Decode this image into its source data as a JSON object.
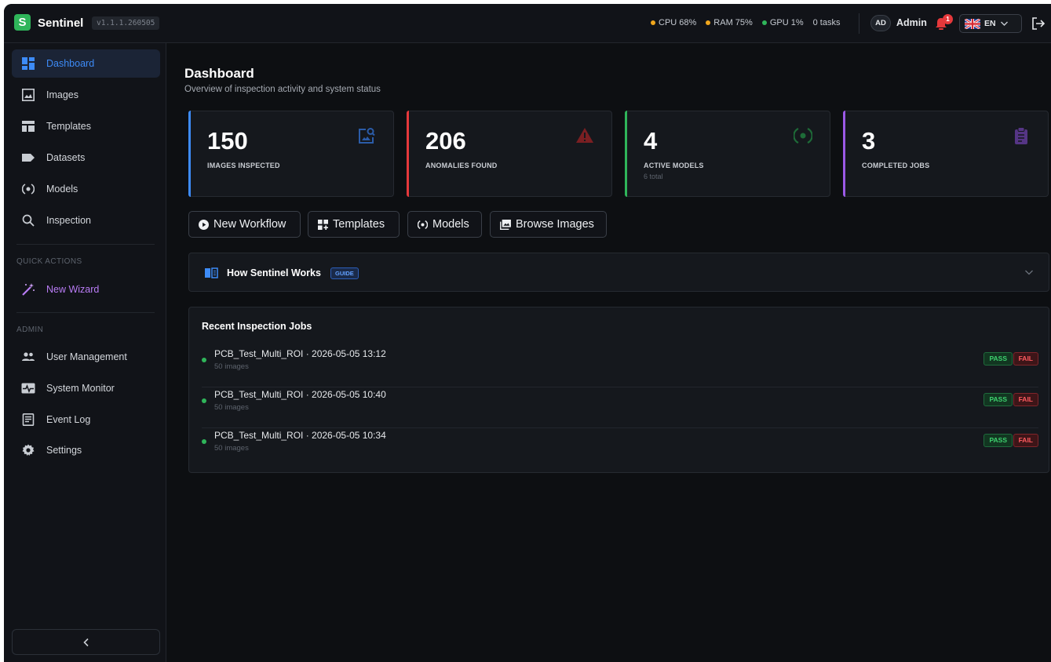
{
  "topbar": {
    "brand_initial": "S",
    "brand": "Sentinel",
    "version": "v1.1.1.260505",
    "stats": [
      {
        "label": "CPU 68%",
        "color": "#f0a61c"
      },
      {
        "label": "RAM 75%",
        "color": "#f0a61c"
      },
      {
        "label": "GPU 1%",
        "color": "#2fb55a"
      },
      {
        "label": "0 tasks",
        "color": ""
      }
    ],
    "avatar_initials": "AD",
    "user_name": "Admin",
    "notification_count": "1",
    "language": "EN"
  },
  "sidebar": {
    "items": [
      {
        "label": "Dashboard",
        "icon": "dashboard-icon"
      },
      {
        "label": "Images",
        "icon": "image-icon"
      },
      {
        "label": "Templates",
        "icon": "template-icon"
      },
      {
        "label": "Datasets",
        "icon": "label-icon"
      },
      {
        "label": "Models",
        "icon": "model-icon"
      },
      {
        "label": "Inspection",
        "icon": "search-icon"
      }
    ],
    "quick_actions_label": "QUICK ACTIONS",
    "quick_actions": [
      {
        "label": "New Wizard",
        "icon": "magic-wand-icon"
      }
    ],
    "admin_label": "ADMIN",
    "admin_items": [
      {
        "label": "User Management",
        "icon": "users-icon"
      },
      {
        "label": "System Monitor",
        "icon": "monitor-heart-icon"
      },
      {
        "label": "Event Log",
        "icon": "log-icon"
      },
      {
        "label": "Settings",
        "icon": "gear-icon"
      }
    ],
    "collapse_icon": "chevron-left-icon"
  },
  "main": {
    "title": "Dashboard",
    "subtitle": "Overview of inspection activity and system status",
    "cards": [
      {
        "value": "150",
        "label": "IMAGES INSPECTED",
        "sub": "",
        "color": "#3d8bf7"
      },
      {
        "value": "206",
        "label": "ANOMALIES FOUND",
        "sub": "",
        "color": "#e5383b"
      },
      {
        "value": "4",
        "label": "ACTIVE MODELS",
        "sub": "6 total",
        "color": "#2fb55a"
      },
      {
        "value": "3",
        "label": "COMPLETED JOBS",
        "sub": "",
        "color": "#9b59e6"
      }
    ],
    "actions": [
      {
        "label": "New Workflow",
        "icon": "play-circle-icon"
      },
      {
        "label": "Templates",
        "icon": "template-icon"
      },
      {
        "label": "Models",
        "icon": "model-icon"
      },
      {
        "label": "Browse Images",
        "icon": "images-icon"
      }
    ],
    "guide": {
      "title": "How Sentinel Works",
      "badge": "GUIDE"
    },
    "jobs": {
      "title": "Recent Inspection Jobs",
      "rows": [
        {
          "name": "PCB_Test_Multi_ROI · 2026-05-05 13:12",
          "meta": "50 images",
          "pass": "PASS",
          "fail": "FAIL"
        },
        {
          "name": "PCB_Test_Multi_ROI · 2026-05-05 10:40",
          "meta": "50 images",
          "pass": "PASS",
          "fail": "FAIL"
        },
        {
          "name": "PCB_Test_Multi_ROI · 2026-05-05 10:34",
          "meta": "50 images",
          "pass": "PASS",
          "fail": "FAIL"
        }
      ]
    }
  }
}
